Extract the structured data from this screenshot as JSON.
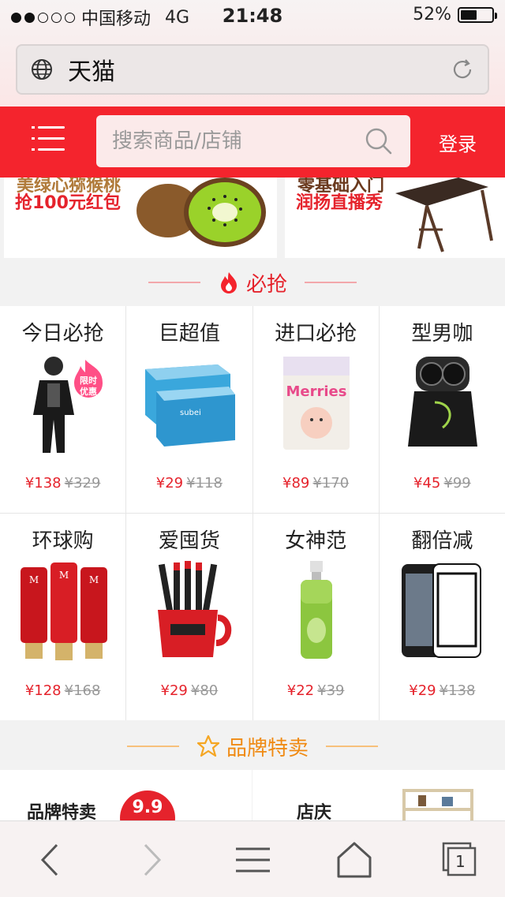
{
  "status_bar": {
    "carrier": "中国移动",
    "network": "4G",
    "time": "21:48",
    "battery": "52%",
    "battery_level": 0.52
  },
  "url_bar": {
    "title": "天猫"
  },
  "header": {
    "search_placeholder": "搜索商品/店铺",
    "login": "登录"
  },
  "banners": [
    {
      "line1": "美绿心猕猴桃",
      "line2": "抢100元红包"
    },
    {
      "line1": "零基础入门",
      "line2": "润扬直播秀"
    }
  ],
  "flash_sale": {
    "title": "必抢",
    "items": [
      {
        "name": "今日必抢",
        "price": "¥138",
        "old": "¥329",
        "tag": "限时\n优惠"
      },
      {
        "name": "巨超值",
        "price": "¥29",
        "old": "¥118"
      },
      {
        "name": "进口必抢",
        "price": "¥89",
        "old": "¥170"
      },
      {
        "name": "型男咖",
        "price": "¥45",
        "old": "¥99"
      },
      {
        "name": "环球购",
        "price": "¥128",
        "old": "¥168"
      },
      {
        "name": "爱囤货",
        "price": "¥29",
        "old": "¥80"
      },
      {
        "name": "女神范",
        "price": "¥22",
        "old": "¥39"
      },
      {
        "name": "翻倍减",
        "price": "¥29",
        "old": "¥138"
      }
    ]
  },
  "brand_sale": {
    "title": "品牌特卖",
    "cards": [
      {
        "label": "品牌特卖",
        "badge": "9.9"
      },
      {
        "label": "店庆"
      }
    ]
  },
  "toolbar": {
    "tabs_count": "1"
  },
  "colors": {
    "accent": "#f4242d",
    "price": "#e5232c",
    "brand_orange": "#f5a623"
  }
}
